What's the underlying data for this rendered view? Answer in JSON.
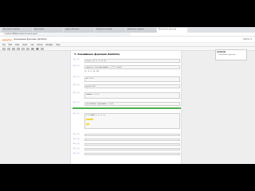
{
  "browser": {
    "tabs": [
      {
        "label": "Интенсив по Python"
      },
      {
        "label": "Курс Python"
      },
      {
        "label": "Jupyter Notebook"
      },
      {
        "label": "Документы Google"
      },
      {
        "label": "Домашнее задание"
      },
      {
        "label": "Анонимные функции"
      }
    ],
    "url": "localhost:8888/notebooks/Lambda.ipynb"
  },
  "jupyter": {
    "logo": "jupyter",
    "notebook_title": "Анонимные функции (lambda)",
    "right_status": "Python 3",
    "menu": [
      "File",
      "Edit",
      "View",
      "Insert",
      "Cell",
      "Kernel",
      "Widgets",
      "Help"
    ],
    "toolbar": [
      "+",
      "✂",
      "⧉",
      "⎘",
      "↑",
      "↓",
      "▶",
      "■",
      "↻"
    ]
  },
  "notebook": {
    "heading": "7. Анонимные функции (lambda)",
    "cells": [
      {
        "prompt": "In [ ]:",
        "code": "items = [1, 2, 3, 4, 5]",
        "output": ""
      },
      {
        "prompt": "In [ ]:",
        "code": "squared = list(map(lambda x: x**2, items))",
        "output": "[1, 4, 9, 16, 25]"
      },
      {
        "prompt": "In [ ]:",
        "code": "def f(x):",
        "output": ""
      },
      {
        "prompt": "In [ ]:",
        "code": "print(f(3))",
        "output": ""
      },
      {
        "prompt": "In [ ]:",
        "code": "lambda x: x + 1",
        "output": ""
      },
      {
        "prompt": "In [ ]:",
        "code": "sorted(data, key=lambda x: x[1])",
        "output": ""
      },
      {
        "prompt": "In [ ]:",
        "code": "f = lambda x, y: x + y",
        "output": ""
      },
      {
        "prompt": "In [ ]:",
        "code": "",
        "output": ""
      },
      {
        "prompt": "In [ ]:",
        "code": "",
        "output": ""
      },
      {
        "prompt": "In [ ]:",
        "code": "",
        "output": ""
      },
      {
        "prompt": "In [ ]:",
        "code": "",
        "output": ""
      },
      {
        "prompt": "In [ ]:",
        "code": "",
        "output": ""
      }
    ]
  },
  "toc": {
    "title": "Contents",
    "items": [
      "7. Анонимные функции"
    ]
  }
}
